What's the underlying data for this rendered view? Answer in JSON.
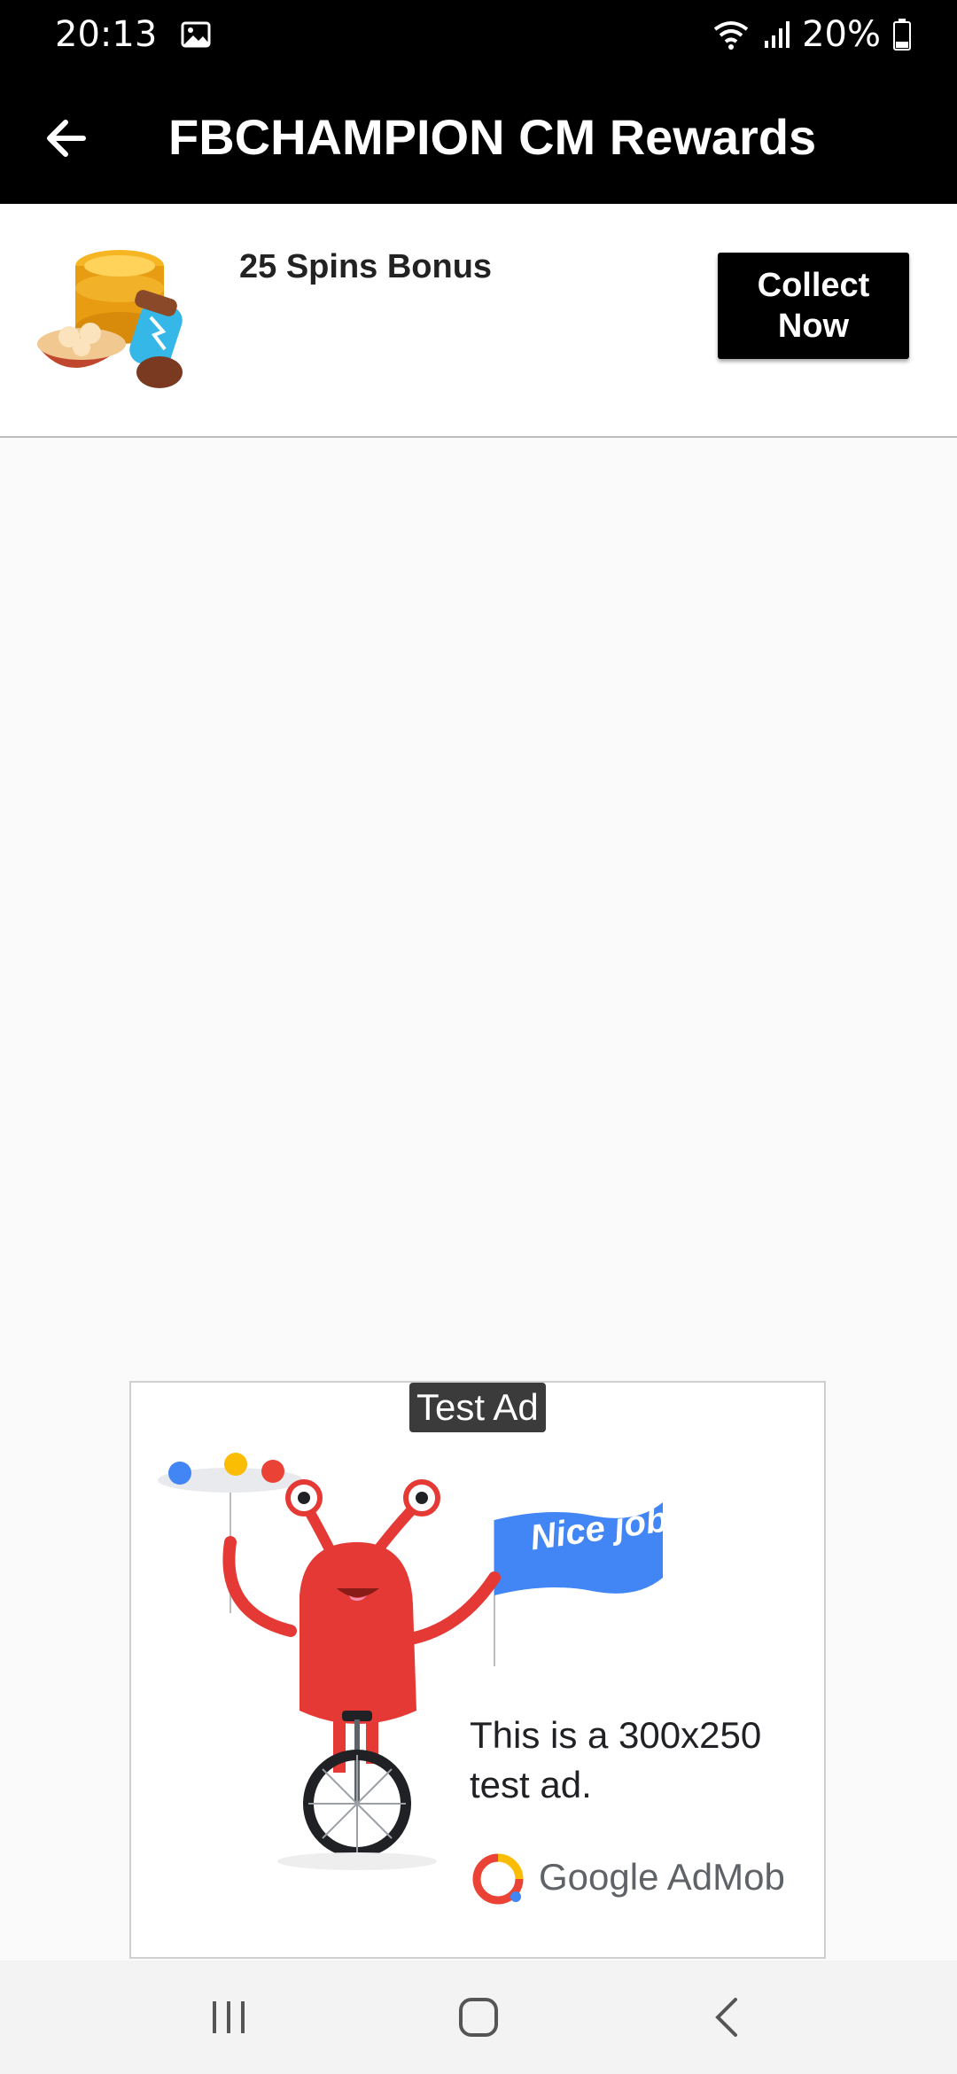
{
  "status": {
    "time": "20:13",
    "battery": "20%"
  },
  "appbar": {
    "title": "FBCHAMPION CM Rewards"
  },
  "reward": {
    "label": "25 Spins Bonus",
    "button_line1": "Collect",
    "button_line2": "Now"
  },
  "ad": {
    "badge": "Test Ad",
    "flag_text": "Nice job!",
    "text_line1": "This is a 300x250",
    "text_line2": "test ad.",
    "brand_google": "Google",
    "brand_admob": "AdMob"
  },
  "colors": {
    "bar": "#000000",
    "page_bg": "#fafafa",
    "flag_blue": "#4285f4",
    "monster_red": "#e53935"
  },
  "icons": [
    "gallery-icon",
    "wifi-icon",
    "signal-icon",
    "battery-icon",
    "back-arrow-icon",
    "coins-spins-icon",
    "recents-icon",
    "home-icon",
    "back-nav-icon"
  ]
}
